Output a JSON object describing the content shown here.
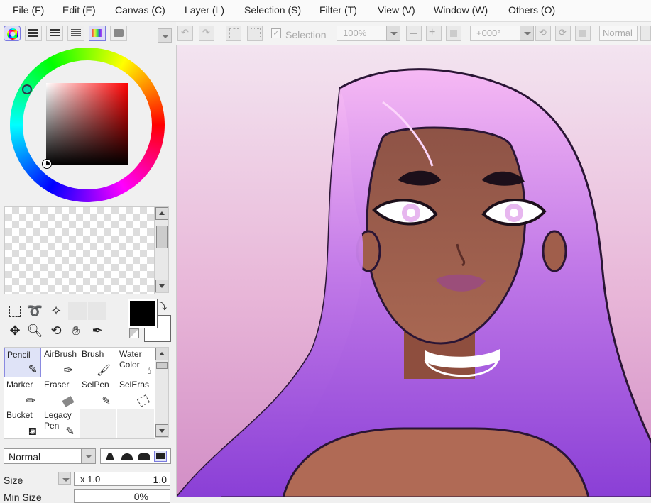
{
  "menu": [
    {
      "label": "File (F)"
    },
    {
      "label": "Edit (E)"
    },
    {
      "label": "Canvas (C)"
    },
    {
      "label": "Layer (L)"
    },
    {
      "label": "Selection (S)"
    },
    {
      "label": "Filter (T)"
    },
    {
      "label": "View (V)"
    },
    {
      "label": "Window (W)"
    },
    {
      "label": "Others (O)"
    }
  ],
  "toolbar": {
    "selection_label": "Selection",
    "zoom_value": "100%",
    "rotation_value": "+000°",
    "blend_value": "Normal"
  },
  "tools": [
    {
      "label": "Pencil",
      "icon": "pencil-icon"
    },
    {
      "label": "AirBrush",
      "icon": "airbrush-icon"
    },
    {
      "label": "Brush",
      "icon": "brush-icon"
    },
    {
      "label": "Water Color",
      "icon": "watercolor-icon"
    },
    {
      "label": "Marker",
      "icon": "marker-icon"
    },
    {
      "label": "Eraser",
      "icon": "eraser-icon"
    },
    {
      "label": "SelPen",
      "icon": "selpen-icon"
    },
    {
      "label": "SelEras",
      "icon": "seleras-icon"
    },
    {
      "label": "Bucket",
      "icon": "bucket-icon"
    },
    {
      "label": "Legacy Pen",
      "icon": "legacy-pen-icon"
    }
  ],
  "brush": {
    "blend_mode": "Normal",
    "size_label": "Size",
    "size_multiplier": "x 1.0",
    "size_value": "1.0",
    "min_size_label": "Min Size",
    "min_size_value": "0%"
  },
  "colors": {
    "primary": "#000000",
    "secondary": "#ffffff",
    "accent": "#7a7ae0"
  }
}
